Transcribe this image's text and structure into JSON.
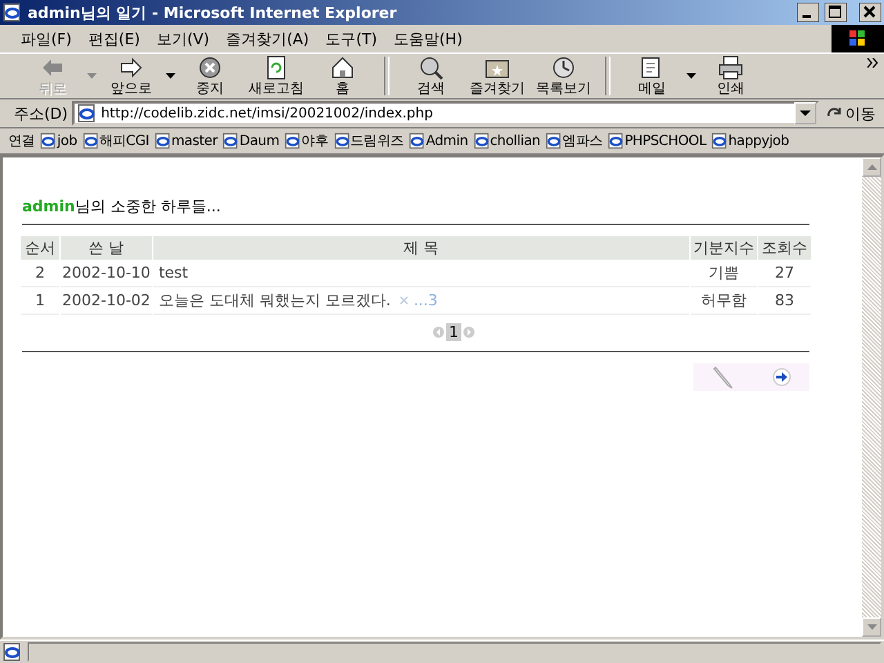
{
  "window": {
    "title": "admin님의 일기 - Microsoft Internet Explorer"
  },
  "menu": [
    "파일(F)",
    "편집(E)",
    "보기(V)",
    "즐겨찾기(A)",
    "도구(T)",
    "도움말(H)"
  ],
  "toolbar": [
    {
      "kind": "back",
      "label": "뒤로",
      "disabled": true,
      "dropdown": true
    },
    {
      "kind": "forward",
      "label": "앞으로",
      "disabled": false,
      "dropdown": true
    },
    {
      "kind": "stop",
      "label": "중지",
      "disabled": false,
      "dropdown": false
    },
    {
      "kind": "refresh",
      "label": "새로고침",
      "disabled": false,
      "dropdown": false
    },
    {
      "kind": "home",
      "label": "홈",
      "disabled": false,
      "dropdown": false
    },
    {
      "kind": "search",
      "label": "검색",
      "disabled": false,
      "dropdown": false
    },
    {
      "kind": "favorites",
      "label": "즐겨찾기",
      "disabled": false,
      "dropdown": false
    },
    {
      "kind": "history",
      "label": "목록보기",
      "disabled": false,
      "dropdown": false
    },
    {
      "kind": "mail",
      "label": "메일",
      "disabled": false,
      "dropdown": true
    },
    {
      "kind": "print",
      "label": "인쇄",
      "disabled": false,
      "dropdown": false
    }
  ],
  "address": {
    "label": "주소(D)",
    "url": "http://codelib.zidc.net/imsi/20021002/index.php",
    "go": "이동"
  },
  "links": {
    "label": "연결",
    "items": [
      "job",
      "해피CGI",
      "master",
      "Daum",
      "야후",
      "드림위즈",
      "Admin",
      "chollian",
      "엠파스",
      "PHPSCHOOL",
      "happyjob"
    ]
  },
  "diary": {
    "owner": "admin",
    "heading": "님의 소중한 하루들...",
    "columns": [
      "순서",
      "쓴 날",
      "제 목",
      "기분지수",
      "조회수"
    ],
    "rows": [
      {
        "no": "2",
        "date": "2002-10-10",
        "title": "test",
        "comments": null,
        "mood": "기쁨",
        "views": "27"
      },
      {
        "no": "1",
        "date": "2002-10-02",
        "title": "오늘은 도대체 뭐했는지 모르겠다.",
        "comments": "...3",
        "mood": "허무함",
        "views": "83"
      }
    ],
    "page": "1"
  }
}
